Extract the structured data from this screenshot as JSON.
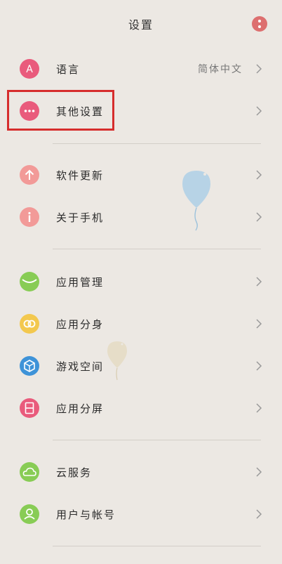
{
  "header": {
    "title": "设置",
    "more_icon": "more-vertical-icon"
  },
  "sections": [
    {
      "items": [
        {
          "name": "language",
          "label": "语言",
          "value": "简体中文",
          "icon": "language-icon",
          "color": "#e95b7c"
        },
        {
          "name": "other-settings",
          "label": "其他设置",
          "icon": "more-dots-icon",
          "color": "#e95b7c",
          "highlighted": true
        }
      ]
    },
    {
      "items": [
        {
          "name": "software-update",
          "label": "软件更新",
          "icon": "upload-arrow-icon",
          "color": "#f29a98"
        },
        {
          "name": "about-phone",
          "label": "关于手机",
          "icon": "info-icon",
          "color": "#f29a98"
        }
      ]
    },
    {
      "items": [
        {
          "name": "app-management",
          "label": "应用管理",
          "icon": "app-management-icon",
          "color": "#88cc55"
        },
        {
          "name": "app-clone",
          "label": "应用分身",
          "icon": "app-clone-icon",
          "color": "#f3c84e"
        },
        {
          "name": "game-space",
          "label": "游戏空间",
          "icon": "game-space-icon",
          "color": "#3e93d8"
        },
        {
          "name": "split-screen",
          "label": "应用分屏",
          "icon": "split-screen-icon",
          "color": "#e95b7c"
        }
      ]
    },
    {
      "items": [
        {
          "name": "cloud-service",
          "label": "云服务",
          "icon": "cloud-icon",
          "color": "#88cc55"
        },
        {
          "name": "user-account",
          "label": "用户与帐号",
          "icon": "user-icon",
          "color": "#88cc55"
        }
      ]
    }
  ],
  "colors": {
    "background": "#ece8e3",
    "highlight_border": "#d62d2d",
    "chevron": "#9a9a9a"
  }
}
